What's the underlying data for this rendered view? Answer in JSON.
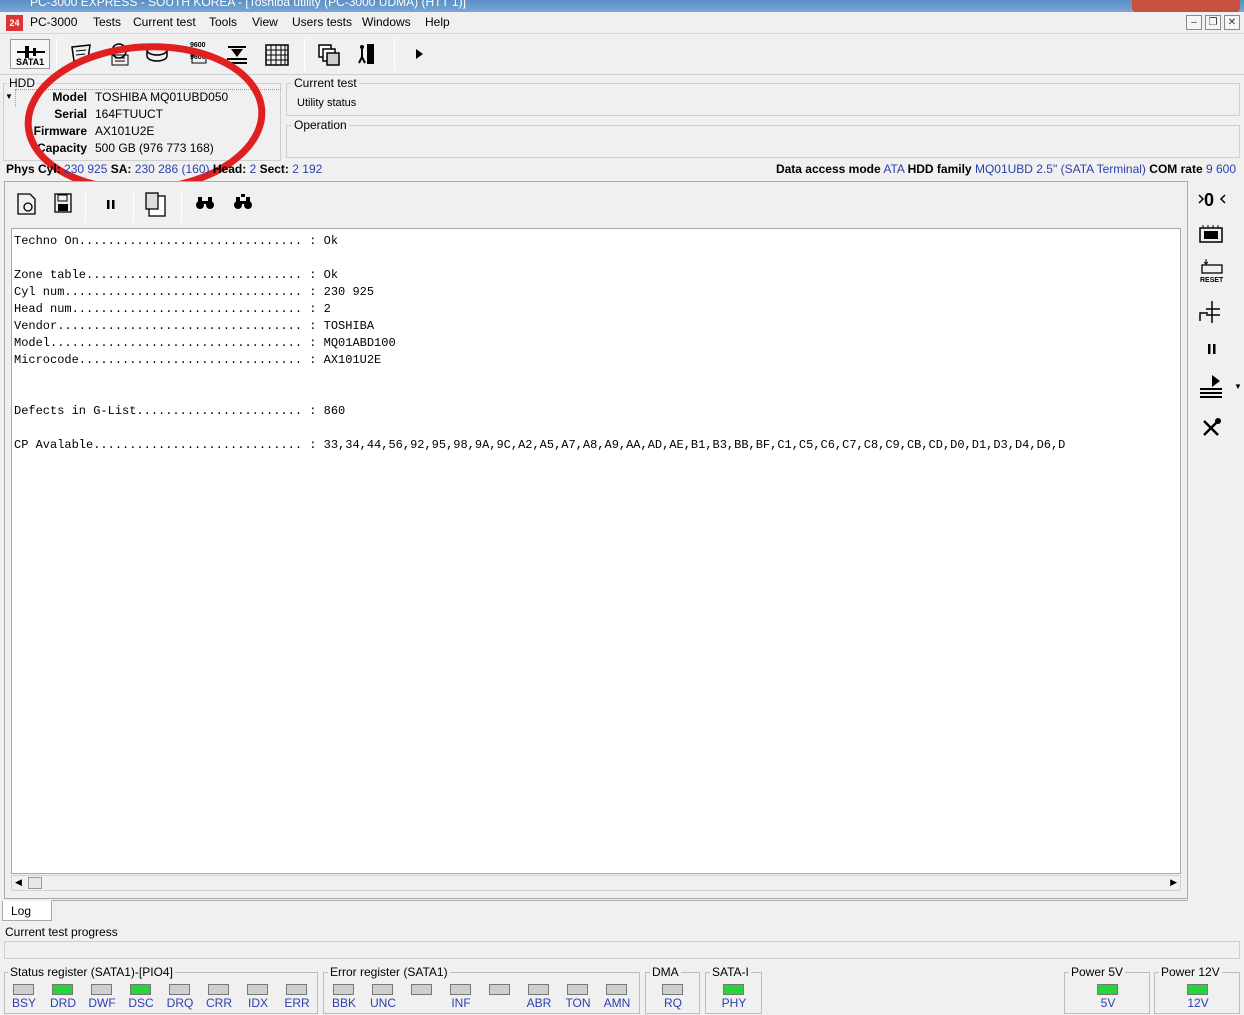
{
  "window": {
    "title": "PC-3000 EXPRESS - SOUTH KOREA - [Toshiba utility (PC-3000 UDMA) (HTT 1)]"
  },
  "menu": {
    "items": [
      "PC-3000",
      "Tests",
      "Current test",
      "Tools",
      "View",
      "Users tests",
      "Windows",
      "Help"
    ]
  },
  "toolbar": {
    "sata_label": "SATA1",
    "baud_top": "9600",
    "baud_bottom": "9600"
  },
  "hdd": {
    "group_title": "HDD",
    "rows": [
      {
        "label": "Model",
        "value": "TOSHIBA MQ01UBD050"
      },
      {
        "label": "Serial",
        "value": "164FTUUCT"
      },
      {
        "label": "Firmware",
        "value": "AX101U2E"
      },
      {
        "label": "Capacity",
        "value": "500 GB (976 773 168)"
      }
    ]
  },
  "current_test": {
    "group_title": "Current test",
    "value": "Utility status"
  },
  "operation": {
    "group_title": "Operation"
  },
  "geometry": {
    "phys_cyl_label": "Phys Cyl:",
    "phys_cyl_value": "230 925",
    "sa_label": "SA:",
    "sa_value": "230 286 (160)",
    "head_label": "Head:",
    "head_value": "2",
    "sect_label": "Sect:",
    "sect_value": "2 192",
    "data_access_label": "Data access mode",
    "data_access_value": "ATA",
    "hdd_family_label": "HDD family",
    "hdd_family_value": "MQ01UBD 2.5\" (SATA Terminal)",
    "com_rate_label": "COM rate",
    "com_rate_value": "9 600"
  },
  "log": {
    "lines": [
      "Techno On............................... : Ok",
      "",
      "Zone table.............................. : Ok",
      "Cyl num................................. : 230 925",
      "Head num................................ : 2",
      "Vendor.................................. : TOSHIBA",
      "Model................................... : MQ01ABD100",
      "Microcode............................... : AX101U2E",
      "",
      "",
      "Defects in G-List....................... : 860",
      "",
      "CP Avalable............................. : 33,34,44,56,92,95,98,9A,9C,A2,A5,A7,A8,A9,AA,AD,AE,B1,B3,BB,BF,C1,C5,C6,C7,C8,C9,CB,CD,D0,D1,D3,D4,D6,D"
    ],
    "tab_label": "Log"
  },
  "right_toolbar": {
    "reset_label": "RESET"
  },
  "progress": {
    "label": "Current test progress"
  },
  "status_register": {
    "title": "Status register (SATA1)-[PIO4]",
    "leds": [
      {
        "label": "BSY",
        "on": false
      },
      {
        "label": "DRD",
        "on": true
      },
      {
        "label": "DWF",
        "on": false
      },
      {
        "label": "DSC",
        "on": true
      },
      {
        "label": "DRQ",
        "on": false
      },
      {
        "label": "CRR",
        "on": false
      },
      {
        "label": "IDX",
        "on": false
      },
      {
        "label": "ERR",
        "on": false
      }
    ]
  },
  "error_register": {
    "title": "Error register (SATA1)",
    "leds": [
      {
        "label": "BBK",
        "on": false
      },
      {
        "label": "UNC",
        "on": false
      },
      {
        "label": "",
        "on": false
      },
      {
        "label": "INF",
        "on": false
      },
      {
        "label": "",
        "on": false
      },
      {
        "label": "ABR",
        "on": false
      },
      {
        "label": "TON",
        "on": false
      },
      {
        "label": "AMN",
        "on": false
      }
    ]
  },
  "dma": {
    "title": "DMA",
    "leds": [
      {
        "label": "RQ",
        "on": false
      }
    ]
  },
  "sata": {
    "title": "SATA-I",
    "leds": [
      {
        "label": "PHY",
        "on": true
      }
    ]
  },
  "power5": {
    "title": "Power 5V",
    "leds": [
      {
        "label": "5V",
        "on": true
      }
    ]
  },
  "power12": {
    "title": "Power 12V",
    "leds": [
      {
        "label": "12V",
        "on": true
      }
    ]
  },
  "colors": {
    "value_blue": "#2c3fb0",
    "led_on": "#27d43b",
    "led_off": "#cfcfcf",
    "annotation_red": "#e02020"
  }
}
